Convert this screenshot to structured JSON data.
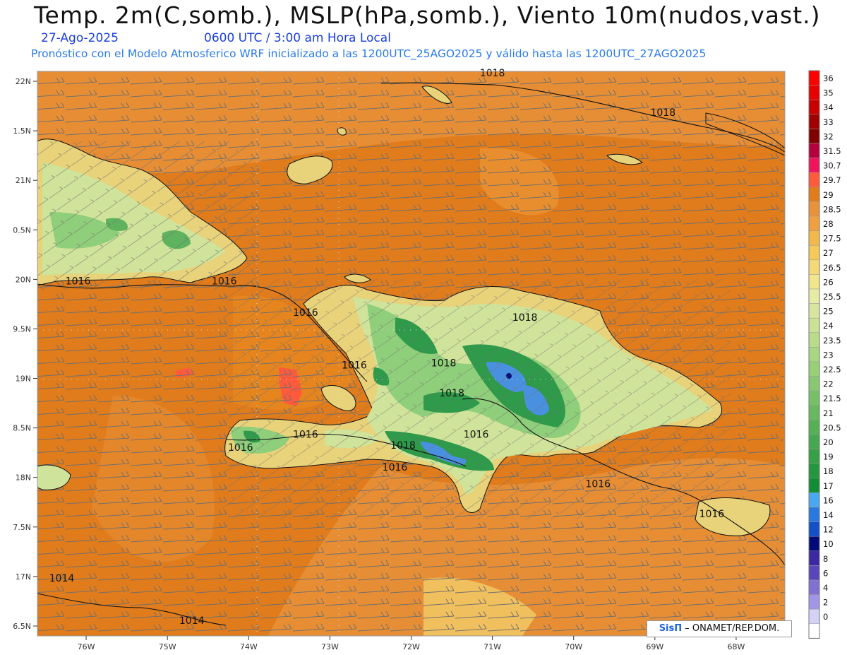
{
  "header": {
    "title": "Temp. 2m(C,somb.), MSLP(hPa,somb.), Viento 10m(nudos,vast.)",
    "date": "27-Ago-2025",
    "time": "0600 UTC / 3:00 am Hora Local",
    "info": "Pronóstico con el Modelo Atmosferico WRF inicializado a las 1200UTC_25AGO2025 y válido hasta las  1200UTC_27AGO2025"
  },
  "credit": {
    "brand": "SisΠ",
    "org": "– ONAMET/REP.DOM."
  },
  "map": {
    "lon_range": [
      -76.6,
      -67.4
    ],
    "lat_range": [
      16.4,
      22.1
    ],
    "lon_ticks": [
      "76W",
      "75W",
      "74W",
      "73W",
      "72W",
      "71W",
      "70W",
      "69W",
      "68W"
    ],
    "lat_ticks": [
      "22N",
      "1.5N",
      "21N",
      "0.5N",
      "20N",
      "9.5N",
      "19N",
      "8.5N",
      "18N",
      "7.5N",
      "17N",
      "6.5N"
    ],
    "lat_values": [
      22,
      21.5,
      21,
      20.5,
      20,
      19.5,
      19,
      18.5,
      18,
      17.5,
      17,
      16.5
    ],
    "lon_values": [
      -76,
      -75,
      -74,
      -73,
      -72,
      -71,
      -70,
      -69,
      -68
    ],
    "colors": {
      "sea": "#e07c1c",
      "sea_light": "#e8923a",
      "land_warm": "#f3cc6a",
      "land_mid": "#cfe39a",
      "land_green": "#8fce7a",
      "mountain": "#2e9a4a",
      "highland": "#4a90e0"
    },
    "isobars": [
      {
        "label": "1018",
        "lon": -71.0,
        "lat": 22.05
      },
      {
        "label": "1018",
        "lon": -68.9,
        "lat": 21.65
      },
      {
        "label": "1016",
        "lon": -76.1,
        "lat": 19.95
      },
      {
        "label": "1016",
        "lon": -74.3,
        "lat": 19.95
      },
      {
        "label": "1016",
        "lon": -73.3,
        "lat": 19.63
      },
      {
        "label": "1018",
        "lon": -70.6,
        "lat": 19.58
      },
      {
        "label": "1016",
        "lon": -72.7,
        "lat": 19.1
      },
      {
        "label": "1018",
        "lon": -71.6,
        "lat": 19.12
      },
      {
        "label": "1018",
        "lon": -71.5,
        "lat": 18.82
      },
      {
        "label": "1016",
        "lon": -73.3,
        "lat": 18.4
      },
      {
        "label": "1016",
        "lon": -74.1,
        "lat": 18.27
      },
      {
        "label": "1018",
        "lon": -72.1,
        "lat": 18.29
      },
      {
        "label": "1016",
        "lon": -71.2,
        "lat": 18.4
      },
      {
        "label": "1016",
        "lon": -72.2,
        "lat": 18.07
      },
      {
        "label": "1016",
        "lon": -69.7,
        "lat": 17.9
      },
      {
        "label": "1016",
        "lon": -68.3,
        "lat": 17.6
      },
      {
        "label": "1014",
        "lon": -76.3,
        "lat": 16.95
      },
      {
        "label": "1014",
        "lon": -74.7,
        "lat": 16.52
      }
    ]
  },
  "legend": {
    "items": [
      {
        "label": "36",
        "color": "#ff0000"
      },
      {
        "label": "35",
        "color": "#e60000"
      },
      {
        "label": "34",
        "color": "#c80000"
      },
      {
        "label": "33",
        "color": "#a00000"
      },
      {
        "label": "32",
        "color": "#800000"
      },
      {
        "label": "31.5",
        "color": "#b4003c"
      },
      {
        "label": "30.7",
        "color": "#f0145a"
      },
      {
        "label": "29.7",
        "color": "#ff5a3c"
      },
      {
        "label": "29",
        "color": "#e07c1c"
      },
      {
        "label": "28.5",
        "color": "#e8923a"
      },
      {
        "label": "28",
        "color": "#f0a040"
      },
      {
        "label": "27.5",
        "color": "#f3b84c"
      },
      {
        "label": "27",
        "color": "#f5c95a"
      },
      {
        "label": "26.5",
        "color": "#f5d878"
      },
      {
        "label": "26",
        "color": "#f0e68c"
      },
      {
        "label": "25.5",
        "color": "#e6eba5"
      },
      {
        "label": "25",
        "color": "#d6e6a0"
      },
      {
        "label": "24",
        "color": "#c8e296"
      },
      {
        "label": "23.5",
        "color": "#b8dc8c"
      },
      {
        "label": "23",
        "color": "#a8d682"
      },
      {
        "label": "22.5",
        "color": "#98d078"
      },
      {
        "label": "22",
        "color": "#88c870"
      },
      {
        "label": "21.5",
        "color": "#78c068"
      },
      {
        "label": "21",
        "color": "#68b860"
      },
      {
        "label": "20.5",
        "color": "#56b056"
      },
      {
        "label": "20",
        "color": "#46a84e"
      },
      {
        "label": "19",
        "color": "#36a046"
      },
      {
        "label": "18",
        "color": "#24963e"
      },
      {
        "label": "17",
        "color": "#128c36"
      },
      {
        "label": "16",
        "color": "#4aa8f0"
      },
      {
        "label": "14",
        "color": "#2878e0"
      },
      {
        "label": "12",
        "color": "#1450c8"
      },
      {
        "label": "10",
        "color": "#000a78"
      },
      {
        "label": "8",
        "color": "#3c28a0"
      },
      {
        "label": "6",
        "color": "#5a46b8"
      },
      {
        "label": "4",
        "color": "#8270d2"
      },
      {
        "label": "2",
        "color": "#a096e6"
      },
      {
        "label": "0",
        "color": "#d2d2f5"
      },
      {
        "label": "",
        "color": "#ffffff"
      }
    ]
  }
}
